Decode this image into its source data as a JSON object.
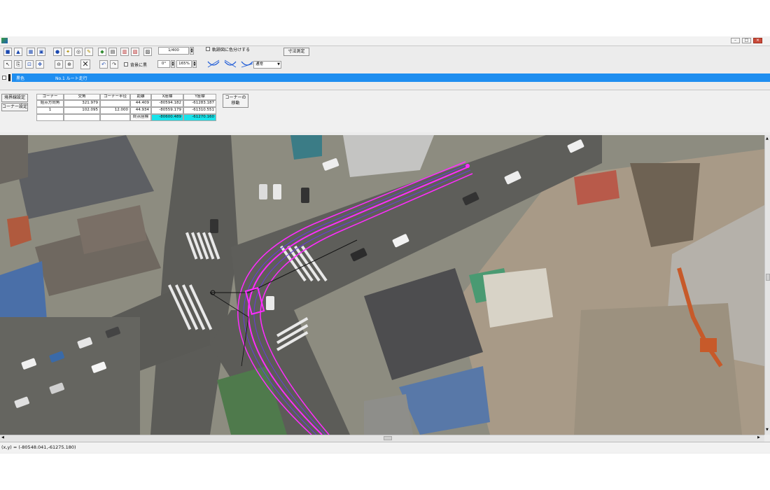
{
  "window": {
    "title": "",
    "controls": [
      "minimize",
      "maximize",
      "close"
    ]
  },
  "toolbar": {
    "row1_icons": [
      "save-icon",
      "car-icon",
      "layer-icon",
      "image-icon",
      "person-icon",
      "light-icon",
      "open-icon",
      "edit-icon",
      "import-icon",
      "grid-icon",
      "print-icon",
      "export-icon",
      "preview-icon"
    ],
    "row2_icons": [
      "pointer-icon",
      "copy-icon",
      "zoom-window-icon",
      "pan-icon",
      "zoom-out-icon",
      "zoom-in-icon",
      "delete-icon",
      "undo-icon",
      "redo-icon"
    ],
    "scale": "1/400",
    "angle": "0°",
    "zoom": "165%",
    "track_color_checkbox_label": "軌跡図に色分けする",
    "background_checkbox_label": "背景に黒",
    "measure_button": "寸法測定",
    "mode_select": "通常",
    "curve_icons": [
      "curve-left-icon",
      "curve-right-icon",
      "curve-both-icon"
    ]
  },
  "layer": {
    "color_name": "黒色",
    "label": "No.1 ルート走行"
  },
  "panel": {
    "side_buttons": [
      "境界線設定",
      "コーナー設定"
    ],
    "headers": [
      "コーナー",
      "交角",
      "コーナー半径",
      "距離",
      "X座標",
      "Y座標"
    ],
    "rows": [
      [
        "始点方向角",
        "321.979",
        "",
        "44.409",
        "-80594.182",
        "-61283.187"
      ],
      [
        "1",
        "102.095",
        "12.000",
        "44.934",
        "-80559.179",
        "-61310.551"
      ],
      [
        "",
        "",
        "",
        "",
        "",
        ""
      ]
    ],
    "end_label": "終点座標",
    "end_x": "-80600.489",
    "end_y": "-61270.160",
    "move_corner_button_lines": [
      "コーナーの",
      "移動"
    ]
  },
  "status": {
    "coordinates": "(x,y) = (-80548.041,-61275.180)"
  },
  "colors": {
    "layer_bar": "#1e8ef0",
    "track_outer": "#ff2cff",
    "track_inner": "#6a3adf",
    "highlight_cell": "#19e3ea"
  }
}
